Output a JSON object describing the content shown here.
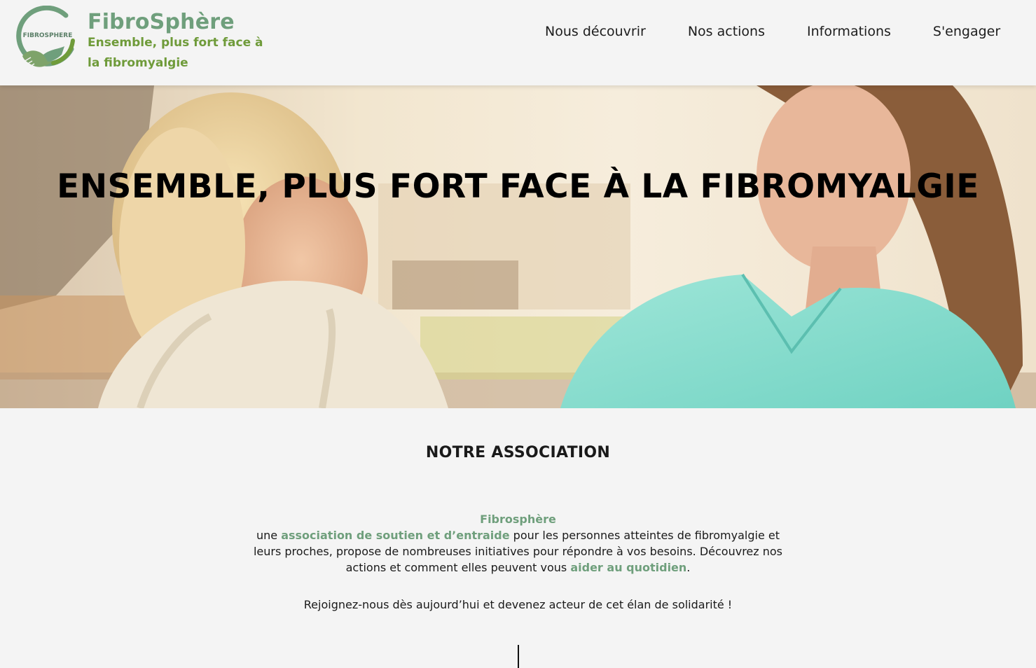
{
  "brand": {
    "logo_text": "FIBROSPHERE",
    "title": "FibroSphère",
    "tagline": "Ensemble, plus fort face à la fibromyalgie"
  },
  "nav": {
    "items": [
      {
        "label": "Nous découvrir"
      },
      {
        "label": "Nos actions"
      },
      {
        "label": "Informations"
      },
      {
        "label": "S'engager"
      }
    ]
  },
  "hero": {
    "title": "ENSEMBLE, PLUS FORT FACE À LA FIBROMYALGIE"
  },
  "about": {
    "title": "NOTRE ASSOCIATION",
    "name": "Fibrosphère",
    "text_1": "une ",
    "highlight_1": "association de soutien et d’entraide",
    "text_2": " pour les personnes atteintes de fibromyalgie et leurs proches, propose de nombreuses initiatives pour répondre à vos besoins. Découvrez nos actions et comment elles peuvent vous ",
    "highlight_2": "aider au quotidien",
    "text_3": ".",
    "cta": "Rejoignez-nous dès aujourd’hui et devenez acteur de cet élan de solidarité !"
  },
  "colors": {
    "brand_green": "#6f9f7c",
    "tagline_green": "#6f9b3a",
    "background": "#f4f4f4"
  }
}
